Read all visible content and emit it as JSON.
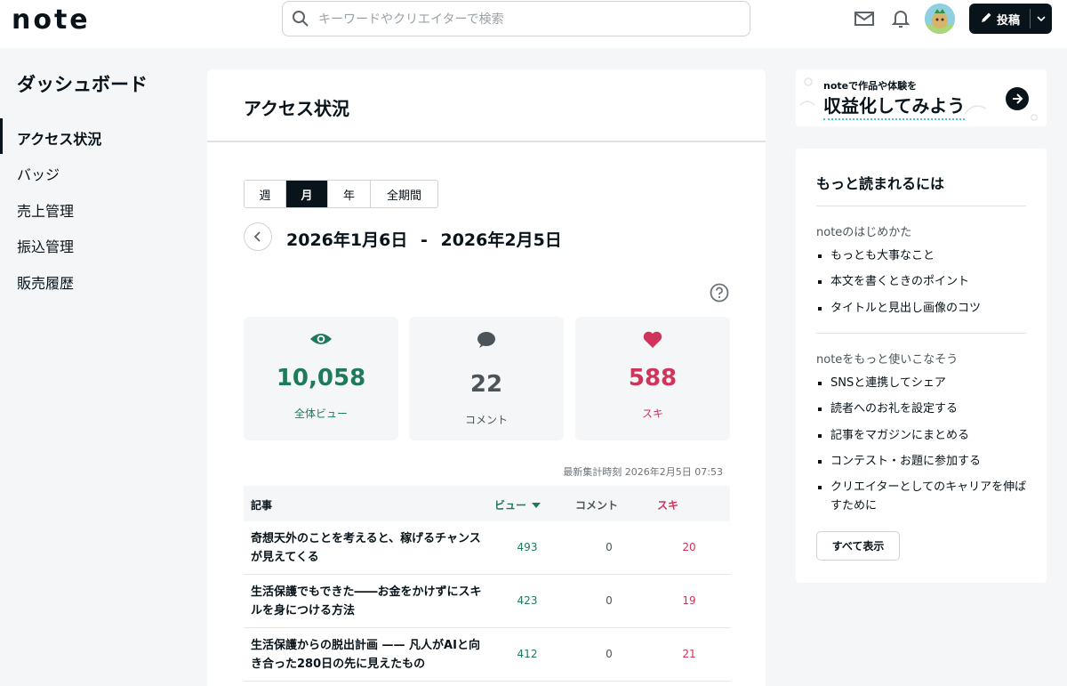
{
  "header": {
    "logo": "note",
    "search_placeholder": "キーワードやクリエイターで検索",
    "post_label": "投稿",
    "icons": [
      "search-icon",
      "mail-icon",
      "bell-icon",
      "pencil-icon",
      "chevron-down-icon"
    ]
  },
  "sidebar": {
    "title": "ダッシュボード",
    "items": [
      {
        "label": "アクセス状況",
        "active": true
      },
      {
        "label": "バッジ"
      },
      {
        "label": "売上管理"
      },
      {
        "label": "振込管理"
      },
      {
        "label": "販売履歴"
      }
    ]
  },
  "main": {
    "title": "アクセス状況",
    "period_tabs": [
      {
        "label": "週"
      },
      {
        "label": "月",
        "active": true
      },
      {
        "label": "年"
      },
      {
        "label": "全期間"
      }
    ],
    "date_from": "2026年1月6日",
    "date_sep": "-",
    "date_to": "2026年2月5日",
    "stats": [
      {
        "value": "10,058",
        "label": "全体ビュー",
        "icon": "eye-icon",
        "color": "#1f7a5c"
      },
      {
        "value": "22",
        "label": "コメント",
        "icon": "comment-icon",
        "color": "#4b5559"
      },
      {
        "value": "588",
        "label": "スキ",
        "icon": "heart-icon",
        "color": "#d0345a"
      }
    ],
    "updated": "最新集計時刻 2026年2月5日 07:53",
    "table": {
      "headers": {
        "article": "記事",
        "views": "ビュー",
        "comments": "コメント",
        "likes": "スキ"
      },
      "rows": [
        {
          "title": "奇想天外のことを考えると、稼げるチャンスが見えてくる",
          "views": "493",
          "comments": "0",
          "likes": "20"
        },
        {
          "title": "生活保護でもできた――お金をかけずにスキルを身につける方法",
          "views": "423",
          "comments": "0",
          "likes": "19"
        },
        {
          "title": "生活保護からの脱出計画 —— 凡人がAIと向き合った280日の先に見えたもの",
          "views": "412",
          "comments": "0",
          "likes": "21"
        }
      ]
    }
  },
  "banner": {
    "small": "noteで作品や体験を",
    "big": "収益化してみよう"
  },
  "help": {
    "title": "もっと読まれるには",
    "section1": "noteのはじめかた",
    "list1": [
      "もっとも大事なこと",
      "本文を書くときのポイント",
      "タイトルと見出し画像のコツ"
    ],
    "section2": "noteをもっと使いこなそう",
    "list2": [
      "SNSと連携してシェア",
      "読者へのお礼を設定する",
      "記事をマガジンにまとめる",
      "コンテスト・お題に参加する",
      "クリエイターとしてのキャリアを伸ばすために"
    ],
    "show_all": "すべて表示"
  },
  "colors": {
    "accent_green": "#1f7a5c",
    "accent_red": "#d0345a",
    "dark": "#08131a"
  }
}
